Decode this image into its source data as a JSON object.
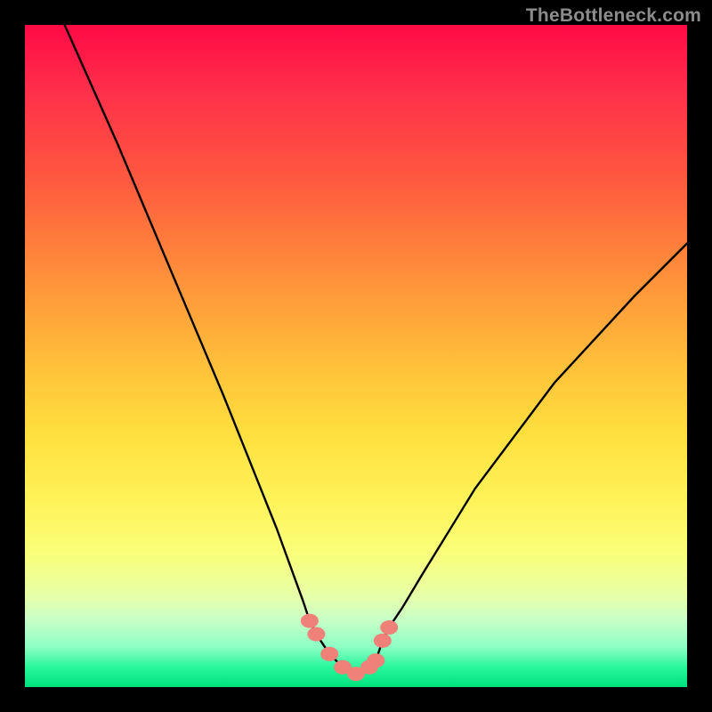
{
  "watermark": {
    "text": "TheBottleneck.com"
  },
  "chart_data": {
    "type": "line",
    "title": "",
    "xlabel": "",
    "ylabel": "",
    "xlim": [
      0,
      100
    ],
    "ylim": [
      0,
      100
    ],
    "series": [
      {
        "name": "bottleneck-curve",
        "x": [
          6,
          14,
          22,
          30,
          38,
          42,
          43,
          44,
          46,
          48,
          50,
          52,
          53,
          54,
          55,
          57,
          60,
          68,
          80,
          92,
          100
        ],
        "y": [
          100,
          82,
          63,
          44,
          24,
          13,
          10,
          8,
          5,
          3,
          2,
          3,
          4,
          7,
          9,
          12,
          17,
          30,
          46,
          59,
          67
        ]
      }
    ],
    "markers": {
      "name": "highlight-dots",
      "x": [
        43,
        44,
        46,
        48,
        50,
        52,
        53,
        54,
        55
      ],
      "y": [
        10,
        8,
        5,
        3,
        2,
        3,
        4,
        7,
        9
      ]
    },
    "background_gradient": {
      "top": "#ff0a46",
      "mid": "#ffe03e",
      "bottom": "#00e07f"
    }
  }
}
